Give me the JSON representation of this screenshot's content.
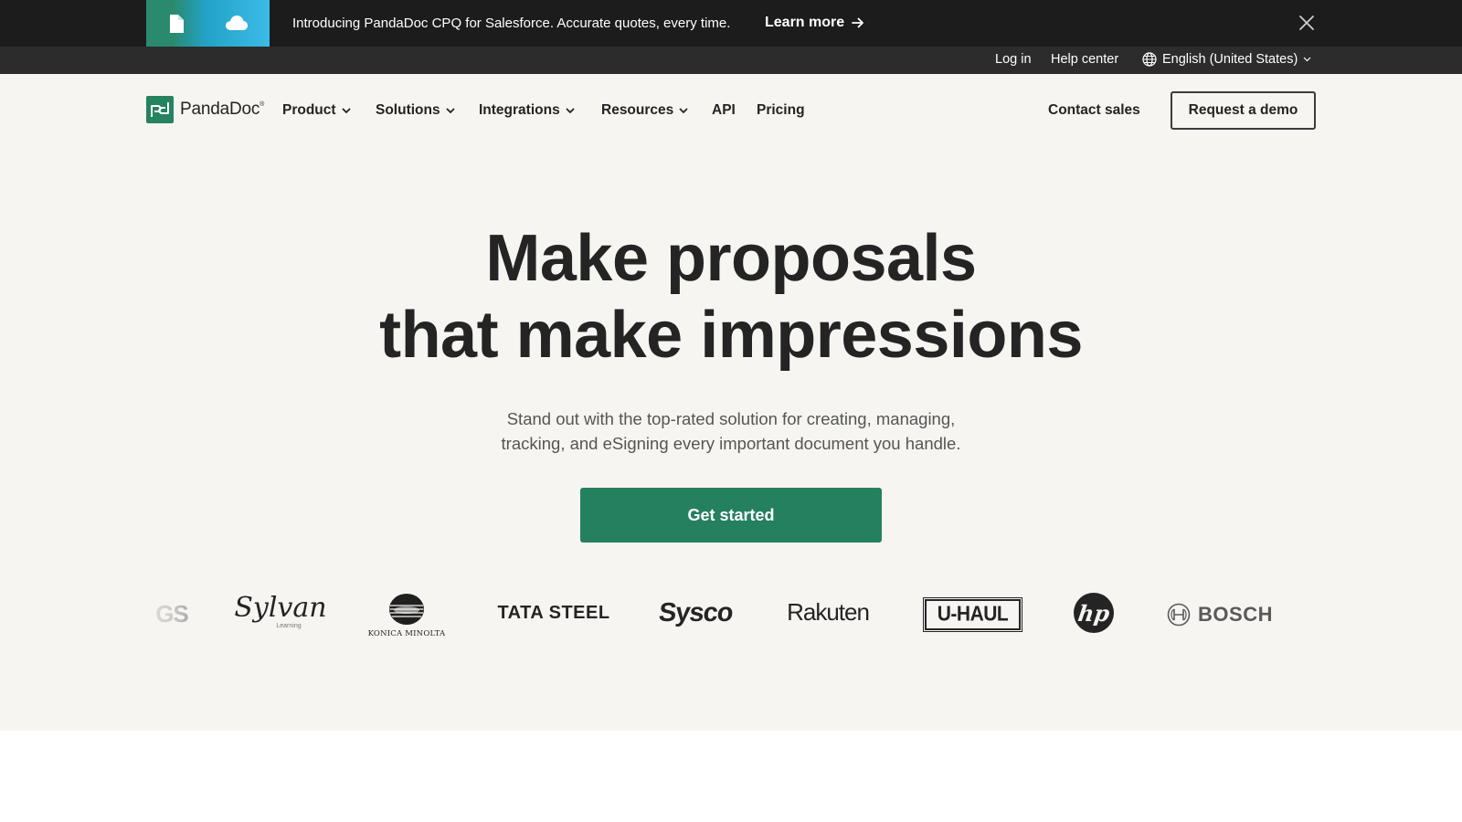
{
  "announcement": {
    "text": "Introducing PandaDoc CPQ for Salesforce. Accurate quotes, every time.",
    "link_label": "Learn more",
    "art_icons": [
      "document-icon",
      "cloud-icon"
    ]
  },
  "utility_nav": {
    "login": "Log in",
    "help": "Help center",
    "language": "English (United States)"
  },
  "brand": {
    "name": "PandaDoc",
    "trademark": "®",
    "color": "#25835f"
  },
  "nav": {
    "items": [
      {
        "label": "Product",
        "has_dropdown": true
      },
      {
        "label": "Solutions",
        "has_dropdown": true
      },
      {
        "label": "Integrations",
        "has_dropdown": true
      },
      {
        "label": "Resources",
        "has_dropdown": true
      },
      {
        "label": "API",
        "has_dropdown": false
      },
      {
        "label": "Pricing",
        "has_dropdown": false
      }
    ],
    "contact_sales": "Contact sales",
    "request_demo": "Request a demo"
  },
  "hero": {
    "title_line1": "Make proposals",
    "title_line2": "that make impressions",
    "subtitle_line1": "Stand out with the top-rated solution for creating, managing,",
    "subtitle_line2": "tracking, and eSigning every important document you handle.",
    "cta_label": "Get started",
    "cta_color": "#24805f"
  },
  "customer_logos": [
    {
      "name": "GS",
      "partial": true
    },
    {
      "name": "Sylvan",
      "sub": "Learning"
    },
    {
      "name": "KONICA MINOLTA"
    },
    {
      "name": "TATA STEEL"
    },
    {
      "name": "Sysco"
    },
    {
      "name": "Rakuten"
    },
    {
      "name": "U-HAUL"
    },
    {
      "name": "hp"
    },
    {
      "name": "BOSCH"
    }
  ]
}
